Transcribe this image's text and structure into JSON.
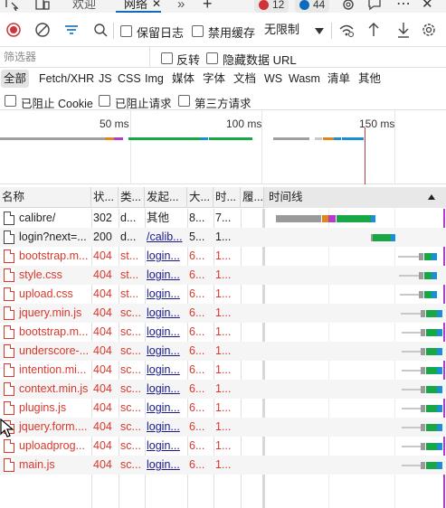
{
  "tabs": {
    "welcome": "欢迎",
    "network": "网络",
    "more": "»",
    "add": "+",
    "errors": "12",
    "messages": "44",
    "menu": "⋯",
    "close": "✕"
  },
  "toolbar": {
    "preserve_log": "保留日志",
    "disable_cache": "禁用缓存",
    "throttling": "无限制"
  },
  "filter": {
    "placeholder": "筛选器",
    "invert": "反转",
    "hide_data_urls": "隐藏数据 URL"
  },
  "types": [
    "全部",
    "Fetch/XHR",
    "JS",
    "CSS",
    "Img",
    "媒体",
    "字体",
    "文档",
    "WS",
    "Wasm",
    "清单",
    "其他"
  ],
  "blocked": {
    "blocked_cookies": "已阻止 Cookie",
    "blocked_requests": "已阻止请求",
    "third_party": "第三方请求"
  },
  "overview": {
    "ticks": [
      "50 ms",
      "100 ms",
      "150 ms"
    ]
  },
  "columns": {
    "name": "名称",
    "status": "状...",
    "type": "类...",
    "initiator": "发起...",
    "size": "大...",
    "time": "时...",
    "fulfilled": "履...",
    "waterfall": "时间线"
  },
  "requests": [
    {
      "name": "calibre/",
      "status": "302",
      "type": "d...",
      "initiator": "其他",
      "size": "8...",
      "time": "7...",
      "error": false
    },
    {
      "name": "login?next=...",
      "status": "200",
      "type": "d...",
      "initiator": "/calib...",
      "size": "5...",
      "time": "1...",
      "error": false
    },
    {
      "name": "bootstrap.m...",
      "status": "404",
      "type": "st...",
      "initiator": "login...",
      "size": "6...",
      "time": "1...",
      "error": true
    },
    {
      "name": "style.css",
      "status": "404",
      "type": "st...",
      "initiator": "login...",
      "size": "6...",
      "time": "1...",
      "error": true
    },
    {
      "name": "upload.css",
      "status": "404",
      "type": "st...",
      "initiator": "login...",
      "size": "6...",
      "time": "1...",
      "error": true
    },
    {
      "name": "jquery.min.js",
      "status": "404",
      "type": "sc...",
      "initiator": "login...",
      "size": "6...",
      "time": "1...",
      "error": true
    },
    {
      "name": "bootstrap.m...",
      "status": "404",
      "type": "sc...",
      "initiator": "login...",
      "size": "6...",
      "time": "1...",
      "error": true
    },
    {
      "name": "underscore-...",
      "status": "404",
      "type": "sc...",
      "initiator": "login...",
      "size": "6...",
      "time": "1...",
      "error": true
    },
    {
      "name": "intention.mi...",
      "status": "404",
      "type": "sc...",
      "initiator": "login...",
      "size": "6...",
      "time": "1...",
      "error": true
    },
    {
      "name": "context.min.js",
      "status": "404",
      "type": "sc...",
      "initiator": "login...",
      "size": "6...",
      "time": "1...",
      "error": true
    },
    {
      "name": "plugins.js",
      "status": "404",
      "type": "sc...",
      "initiator": "login...",
      "size": "6...",
      "time": "1...",
      "error": true
    },
    {
      "name": "jquery.form....",
      "status": "404",
      "type": "sc...",
      "initiator": "login...",
      "size": "6...",
      "time": "1...",
      "error": true
    },
    {
      "name": "uploadprog...",
      "status": "404",
      "type": "sc...",
      "initiator": "login...",
      "size": "6...",
      "time": "1...",
      "error": true
    },
    {
      "name": "main.js",
      "status": "404",
      "type": "sc...",
      "initiator": "login...",
      "size": "6...",
      "time": "1...",
      "error": true
    }
  ],
  "colors": {
    "accent": "#0f6cbd",
    "error_text": "#d9382c",
    "error_badge": "#d13438",
    "info_badge": "#0f6cbd",
    "record": "#d13438",
    "waiting": "#17a845",
    "download": "#1a8fd8",
    "stalled": "#9a9a9a",
    "dns": "#e0861e",
    "connect": "#b43cc8"
  }
}
